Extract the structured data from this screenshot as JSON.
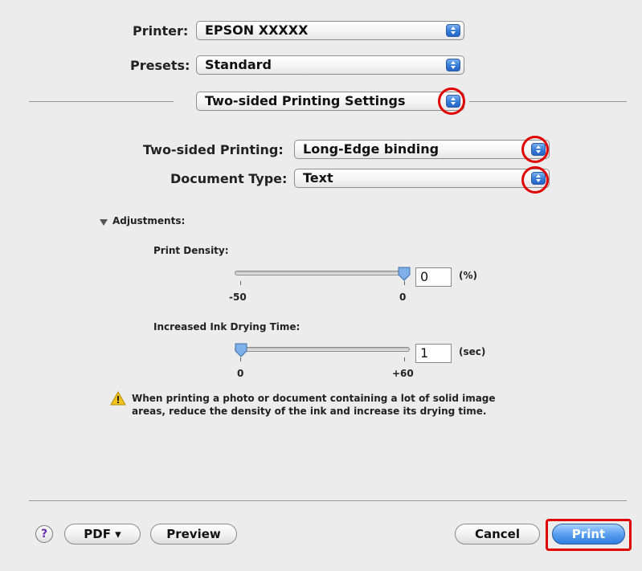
{
  "printer": {
    "label": "Printer:",
    "value": "EPSON XXXXX"
  },
  "presets": {
    "label": "Presets:",
    "value": "Standard"
  },
  "panel_menu": {
    "value": "Two-sided Printing Settings"
  },
  "two_sided": {
    "label": "Two-sided Printing:",
    "value": "Long-Edge binding"
  },
  "doc_type": {
    "label": "Document Type:",
    "value": "Text"
  },
  "adjustments": {
    "label": "Adjustments:"
  },
  "print_density": {
    "label": "Print Density:",
    "value": "0",
    "unit": "(%)",
    "min_label": "-50",
    "max_label": "0",
    "level": 1.0
  },
  "drying_time": {
    "label": "Increased Ink Drying Time:",
    "value": "1",
    "unit": "(sec)",
    "min_label": "0",
    "max_label": "+60",
    "level": 0.0
  },
  "warning": {
    "line1": "When printing a photo or document containing a lot of solid image",
    "line2": "areas, reduce the density of the ink and increase its drying time."
  },
  "buttons": {
    "help": "?",
    "pdf": "PDF ▾",
    "preview": "Preview",
    "cancel": "Cancel",
    "print": "Print"
  },
  "colors": {
    "highlight": "#e00000",
    "accent": "#3a7fd8"
  }
}
